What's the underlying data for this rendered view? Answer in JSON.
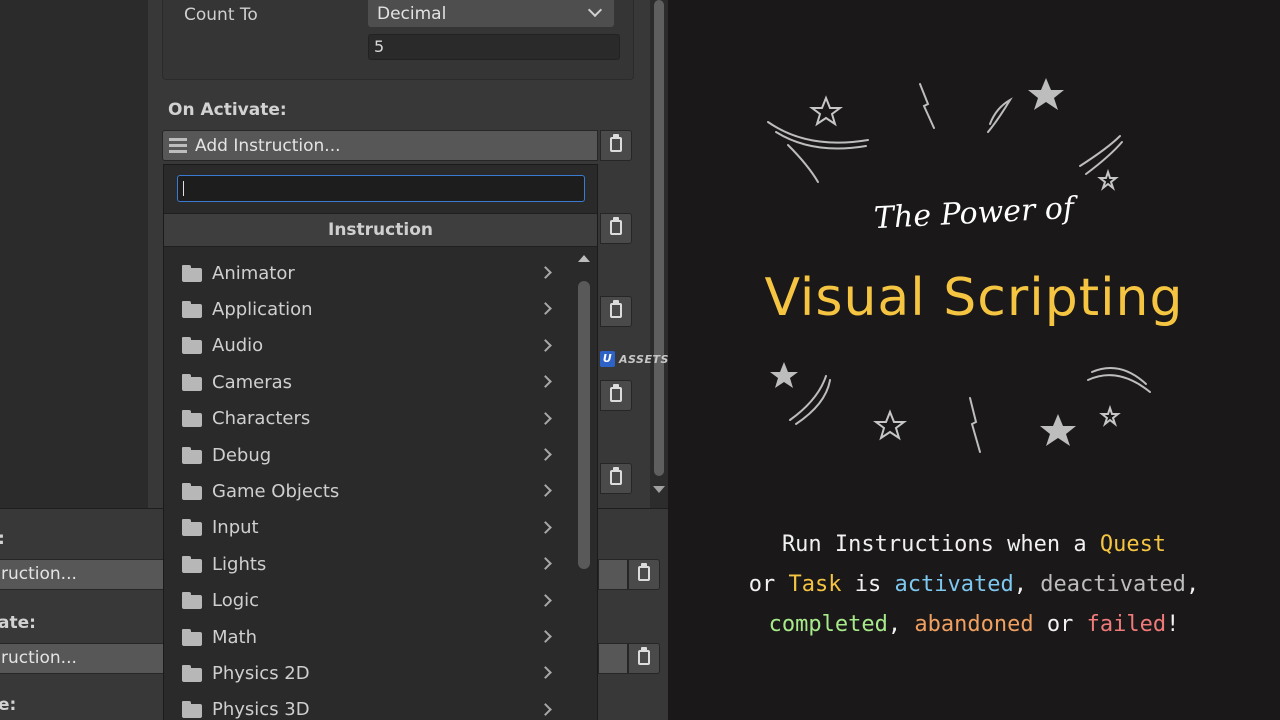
{
  "inspector": {
    "count_to_label": "Count To",
    "count_to_type": "Decimal",
    "count_to_value": "5",
    "on_activate_label": "On Activate:",
    "add_instruction_label": "Add Instruction..."
  },
  "lower": {
    "rows": [
      {
        "label": ":",
        "button": "ruction..."
      },
      {
        "label": "ate:",
        "button": "ruction..."
      },
      {
        "label": "e:"
      }
    ]
  },
  "popup": {
    "search_value": "",
    "header": "Instruction",
    "items": [
      {
        "label": "Animator"
      },
      {
        "label": "Application"
      },
      {
        "label": "Audio"
      },
      {
        "label": "Cameras"
      },
      {
        "label": "Characters"
      },
      {
        "label": "Debug"
      },
      {
        "label": "Game Objects"
      },
      {
        "label": "Input"
      },
      {
        "label": "Lights"
      },
      {
        "label": "Logic"
      },
      {
        "label": "Math"
      },
      {
        "label": "Physics 2D"
      },
      {
        "label": "Physics 3D"
      }
    ]
  },
  "watermark": {
    "badge": "U",
    "text": "ASSETS"
  },
  "promo": {
    "subtitle": "The Power of",
    "title": "Visual Scripting",
    "line1": {
      "a": "Run Instructions when a ",
      "b": "Quest"
    },
    "line2": {
      "a": "or ",
      "b": "Task",
      "c": " is ",
      "d": "activated",
      "e": ", ",
      "f": "deactivated",
      "g": ","
    },
    "line3": {
      "a": "completed",
      "b": ", ",
      "c": "abandoned",
      "d": " or ",
      "e": "failed",
      "f": "!"
    },
    "colors": {
      "title": "#f5c542",
      "activated": "#7ec8f0",
      "completed": "#a6ea8a",
      "abandoned": "#f0a060",
      "failed": "#f07a7a"
    }
  }
}
